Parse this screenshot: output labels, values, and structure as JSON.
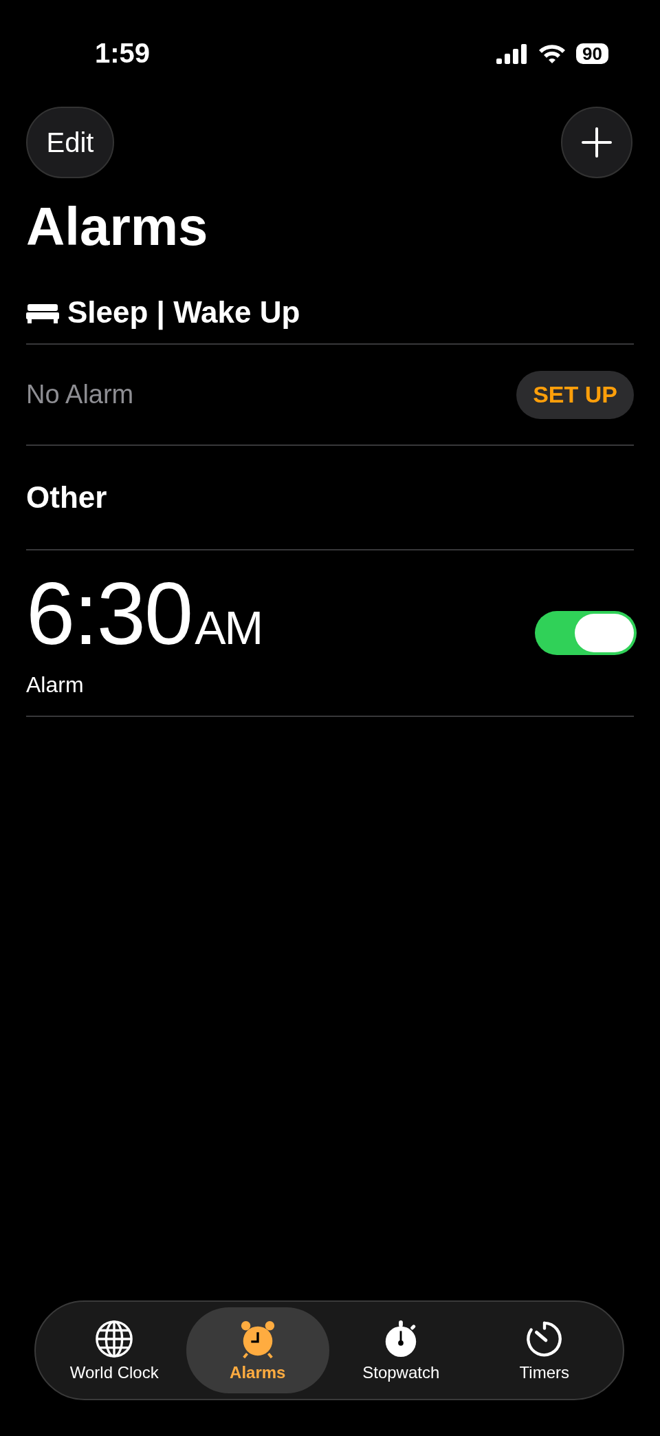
{
  "status_bar": {
    "time": "1:59",
    "battery": "90"
  },
  "toolbar": {
    "edit": "Edit"
  },
  "title": "Alarms",
  "sleep": {
    "heading": "Sleep | Wake Up",
    "text": "No Alarm",
    "button": "SET UP"
  },
  "other": {
    "heading": "Other"
  },
  "alarms": [
    {
      "time": "6:30",
      "period": "AM",
      "label": "Alarm",
      "on": true
    }
  ],
  "tabs": [
    {
      "label": "World Clock",
      "kind": "globe",
      "selected": false
    },
    {
      "label": "Alarms",
      "kind": "alarm",
      "selected": true
    },
    {
      "label": "Stopwatch",
      "kind": "stopwatch",
      "selected": false
    },
    {
      "label": "Timers",
      "kind": "timer",
      "selected": false
    }
  ]
}
